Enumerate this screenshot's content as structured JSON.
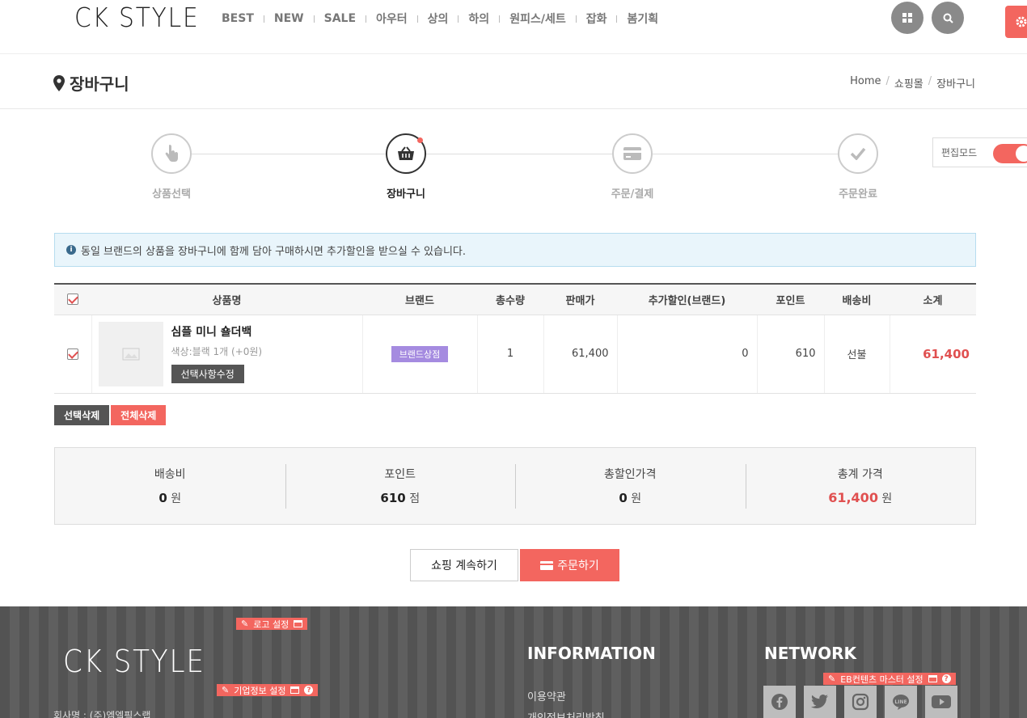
{
  "header": {
    "logo": "CK STYLE",
    "nav": [
      "BEST",
      "NEW",
      "SALE",
      "아우터",
      "상의",
      "하의",
      "원피스/세트",
      "잡화",
      "봄기획"
    ]
  },
  "page": {
    "title": "장바구니",
    "breadcrumb": [
      "Home",
      "쇼핑몰",
      "장바구니"
    ]
  },
  "steps": [
    {
      "label": "상품선택",
      "icon": "hand-pointer-icon"
    },
    {
      "label": "장바구니",
      "icon": "basket-icon"
    },
    {
      "label": "주문/결제",
      "icon": "credit-card-icon"
    },
    {
      "label": "주문완료",
      "icon": "check-icon"
    }
  ],
  "edit_mode": {
    "label": "편집모드"
  },
  "notice": {
    "text": "동일 브랜드의 상품을 장바구니에 함께 담아 구매하시면 추가할인을 받으실 수 있습니다."
  },
  "cart": {
    "headers": [
      "상품명",
      "브랜드",
      "총수량",
      "판매가",
      "추가할인(브랜드)",
      "포인트",
      "배송비",
      "소계"
    ],
    "items": [
      {
        "name": "심플 미니 숄더백",
        "option": "색상:블랙 1개 (+0원)",
        "edit_label": "선택사항수정",
        "brand": "브랜드상점",
        "qty": "1",
        "price": "61,400",
        "discount": "0",
        "point": "610",
        "shipping": "선불",
        "subtotal": "61,400"
      }
    ],
    "delete_selected": "선택삭제",
    "delete_all": "전체삭제"
  },
  "summary": {
    "shipping": {
      "label": "배송비",
      "value": "0",
      "unit": "원"
    },
    "points": {
      "label": "포인트",
      "value": "610",
      "unit": "점"
    },
    "discount": {
      "label": "총할인가격",
      "value": "0",
      "unit": "원"
    },
    "total": {
      "label": "총계 가격",
      "value": "61,400",
      "unit": "원"
    }
  },
  "actions": {
    "continue": "쇼핑 계속하기",
    "order": "주문하기"
  },
  "footer": {
    "logo": "CK STYLE",
    "logo_setting": "로고 설정",
    "company_setting": "기업정보 설정",
    "company_name": "회사명 : (주)엠엘픽스랩",
    "info_title": "INFORMATION",
    "info_links": [
      "이용약관",
      "개인정보처리방침"
    ],
    "network_title": "NETWORK",
    "eb_setting": "EB컨텐츠 마스터 설정",
    "sns": [
      "facebook-icon",
      "twitter-icon",
      "instagram-icon",
      "line-icon",
      "youtube-icon"
    ]
  },
  "colors": {
    "accent": "#f3665f",
    "brand_tag": "#a58be0",
    "notice_bg": "#e9f5fb"
  }
}
